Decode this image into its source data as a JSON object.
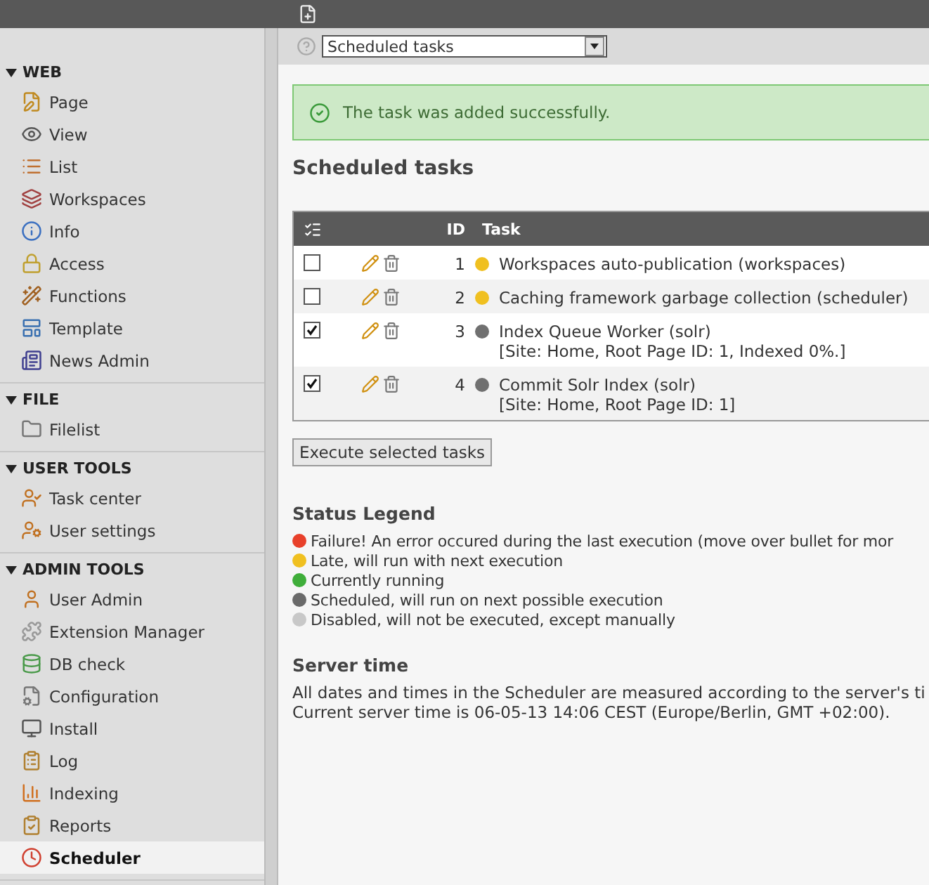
{
  "sidebar": {
    "groups": [
      {
        "title": "WEB",
        "expanded": true,
        "items": [
          {
            "label": "Page",
            "selected": false
          },
          {
            "label": "View",
            "selected": false
          },
          {
            "label": "List",
            "selected": false
          },
          {
            "label": "Workspaces",
            "selected": false
          },
          {
            "label": "Info",
            "selected": false
          },
          {
            "label": "Access",
            "selected": false
          },
          {
            "label": "Functions",
            "selected": false
          },
          {
            "label": "Template",
            "selected": false
          },
          {
            "label": "News Admin",
            "selected": false
          }
        ]
      },
      {
        "title": "FILE",
        "expanded": true,
        "items": [
          {
            "label": "Filelist",
            "selected": false
          }
        ]
      },
      {
        "title": "USER TOOLS",
        "expanded": true,
        "items": [
          {
            "label": "Task center",
            "selected": false
          },
          {
            "label": "User settings",
            "selected": false
          }
        ]
      },
      {
        "title": "ADMIN TOOLS",
        "expanded": true,
        "items": [
          {
            "label": "User Admin",
            "selected": false
          },
          {
            "label": "Extension Manager",
            "selected": false
          },
          {
            "label": "DB check",
            "selected": false
          },
          {
            "label": "Configuration",
            "selected": false
          },
          {
            "label": "Install",
            "selected": false
          },
          {
            "label": "Log",
            "selected": false
          },
          {
            "label": "Indexing",
            "selected": false
          },
          {
            "label": "Reports",
            "selected": false
          },
          {
            "label": "Scheduler",
            "selected": true
          }
        ]
      }
    ]
  },
  "function_menu": {
    "value": "Scheduled tasks"
  },
  "message": {
    "text": "The task was added successfully."
  },
  "title": "Scheduled tasks",
  "table": {
    "columns": [
      "ID",
      "Task"
    ],
    "rows": [
      {
        "checked": false,
        "id": "1",
        "color": "#f0c020",
        "task": "Workspaces auto-publication (workspaces)"
      },
      {
        "checked": false,
        "id": "2",
        "color": "#f0c020",
        "task": "Caching framework garbage collection (scheduler)"
      },
      {
        "checked": true,
        "id": "3",
        "color": "#707070",
        "task": "Index Queue Worker (solr)",
        "detail": "[Site: Home, Root Page ID: 1, Indexed 0%.]"
      },
      {
        "checked": true,
        "id": "4",
        "color": "#707070",
        "task": "Commit Solr Index (solr)",
        "detail": "[Site: Home, Root Page ID: 1]"
      }
    ]
  },
  "execute_button": "Execute selected tasks",
  "legend": {
    "title": "Status Legend",
    "items": [
      {
        "color": "#e8402a",
        "text": "Failure! An error occured during the last execution (move over bullet for mor"
      },
      {
        "color": "#f0c020",
        "text": "Late, will run with next execution"
      },
      {
        "color": "#3fae3a",
        "text": "Currently running"
      },
      {
        "color": "#6a6a6a",
        "text": "Scheduled, will run on next possible execution"
      },
      {
        "color": "#c8c8c8",
        "text": "Disabled, will not be executed, except manually"
      }
    ]
  },
  "server_time": {
    "title": "Server time",
    "lines": [
      "All dates and times in the Scheduler are measured according to the server's ti",
      "Current server time is 06-05-13 14:06 CEST (Europe/Berlin, GMT +02:00)."
    ]
  }
}
